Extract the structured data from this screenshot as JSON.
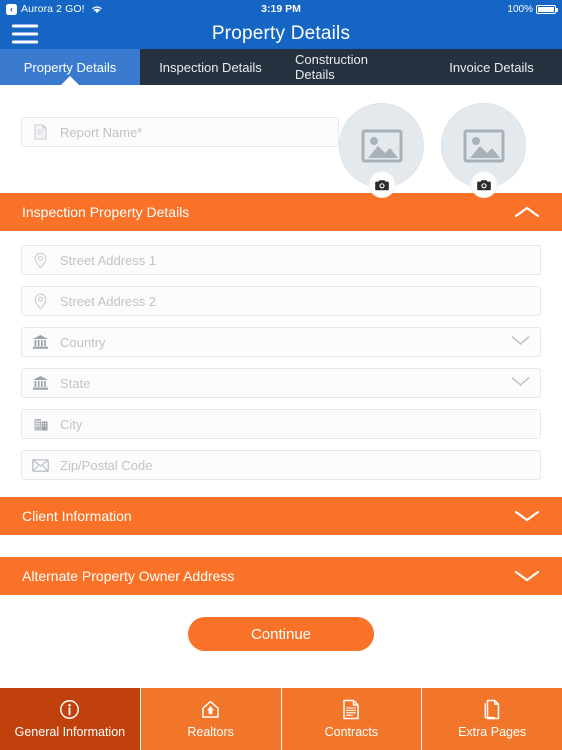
{
  "status_bar": {
    "back_label": "‹",
    "carrier": "Aurora 2 GO!",
    "wifi_icon": "wifi-icon",
    "time": "3:19 PM",
    "battery_percent": "100%",
    "battery_icon": "battery-full-icon"
  },
  "nav": {
    "menu_icon": "hamburger-menu-icon",
    "title": "Property Details"
  },
  "tabs": [
    {
      "label": "Property Details",
      "active": true
    },
    {
      "label": "Inspection Details",
      "active": false
    },
    {
      "label": "Construction Details",
      "active": false
    },
    {
      "label": "Invoice Details",
      "active": false
    }
  ],
  "report": {
    "icon": "document-icon",
    "placeholder": "Report Name*",
    "value": ""
  },
  "photos": [
    {
      "name": "photo-placeholder-1",
      "icon": "image-placeholder-icon",
      "badge_icon": "camera-icon"
    },
    {
      "name": "photo-placeholder-2",
      "icon": "image-placeholder-icon",
      "badge_icon": "camera-icon"
    }
  ],
  "sections": [
    {
      "title": "Inspection Property Details",
      "expanded": true,
      "chevron_icon": "chevron-up-icon",
      "fields": [
        {
          "name": "street-address-1",
          "icon": "location-pin-icon",
          "placeholder": "Street Address 1",
          "value": "",
          "type": "text"
        },
        {
          "name": "street-address-2",
          "icon": "location-pin-icon",
          "placeholder": "Street Address 2",
          "value": "",
          "type": "text"
        },
        {
          "name": "country",
          "icon": "bank-building-icon",
          "placeholder": "Country",
          "value": "",
          "type": "select",
          "select_icon": "chevron-down-icon"
        },
        {
          "name": "state",
          "icon": "bank-building-icon",
          "placeholder": "State",
          "value": "",
          "type": "select",
          "select_icon": "chevron-down-icon"
        },
        {
          "name": "city",
          "icon": "office-building-icon",
          "placeholder": "City",
          "value": "",
          "type": "text"
        },
        {
          "name": "zip-postal-code",
          "icon": "envelope-icon",
          "placeholder": "Zip/Postal Code",
          "value": "",
          "type": "text"
        }
      ]
    },
    {
      "title": "Client Information",
      "expanded": false,
      "chevron_icon": "chevron-down-icon",
      "fields": []
    },
    {
      "title": "Alternate Property Owner Address",
      "expanded": false,
      "chevron_icon": "chevron-down-icon",
      "fields": []
    }
  ],
  "continue_button": {
    "label": "Continue"
  },
  "bottom_nav": [
    {
      "label": "General Information",
      "icon": "info-circle-icon",
      "active": true
    },
    {
      "label": "Realtors",
      "icon": "home-icon",
      "active": false
    },
    {
      "label": "Contracts",
      "icon": "contract-document-icon",
      "active": false
    },
    {
      "label": "Extra Pages",
      "icon": "pages-icon",
      "active": false
    }
  ],
  "colors": {
    "header_blue": "#1565c4",
    "tab_active_blue": "#3a7bd0",
    "tab_inactive_navy": "#263140",
    "accent_orange": "#f97227",
    "bottom_nav_orange": "#f2762a",
    "bottom_nav_active": "#c1410c"
  }
}
